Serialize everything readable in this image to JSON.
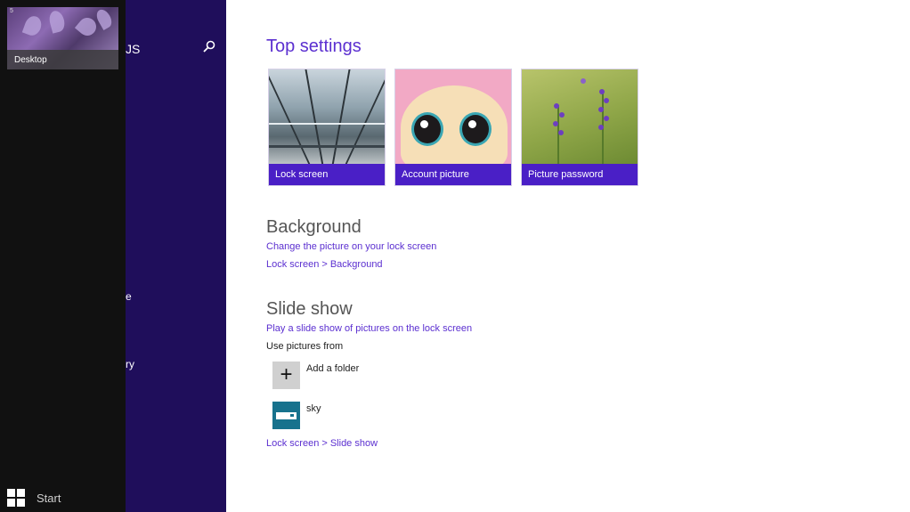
{
  "switcher": {
    "app_thumbnail": {
      "label": "Desktop",
      "number": "5"
    },
    "start_label": "Start"
  },
  "navpane": {
    "title_fragment": "JS",
    "item_fragment_1": "e",
    "item_fragment_2": "ry"
  },
  "top_settings": {
    "heading": "Top settings",
    "tiles": [
      {
        "label": "Lock screen"
      },
      {
        "label": "Account picture"
      },
      {
        "label": "Picture password"
      }
    ]
  },
  "background": {
    "heading": "Background",
    "description_link": "Change the picture on your lock screen",
    "path_link": "Lock screen > Background"
  },
  "slide_show": {
    "heading": "Slide show",
    "description_link": "Play a slide show of pictures on the lock screen",
    "use_pictures_label": "Use pictures from",
    "add_folder_label": "Add a folder",
    "add_icon": "+",
    "folder_name": "sky",
    "path_link": "Lock screen > Slide show"
  },
  "colors": {
    "accent": "#5b2fd0",
    "tile_caption": "#4a1fc6",
    "nav_background": "#1f0e5b",
    "switcher_background": "#111111",
    "folder_tile": "#17728d"
  }
}
